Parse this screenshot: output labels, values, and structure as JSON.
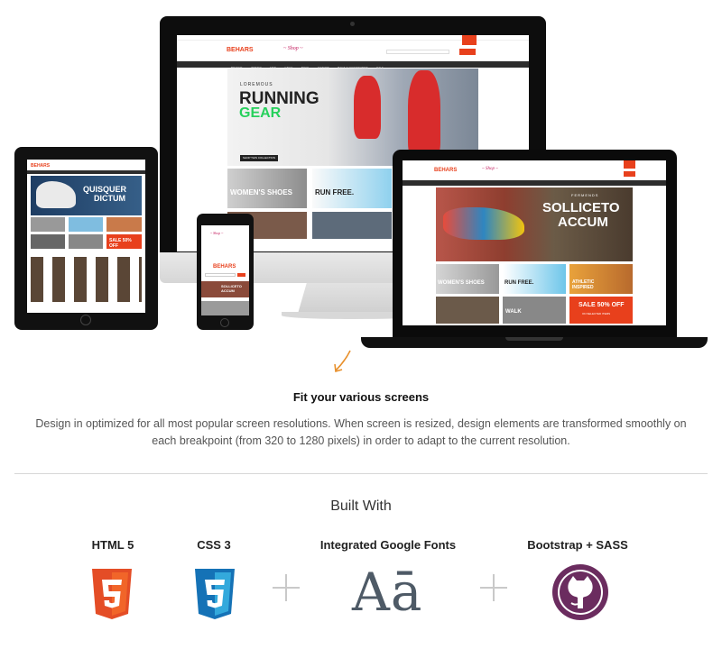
{
  "devices": {
    "imac": {
      "brand": "BEHARS",
      "hero_kicker": "LOREMOUS",
      "hero_line1": "RUNNING",
      "hero_line2": "GEAR",
      "hero_cta": "SHOP THIS COLLECTION",
      "tile1": "WOMEN'S SHOES",
      "tile2": "RUN FREE.",
      "nav": [
        "BRANDS",
        "WOMEN",
        "MEN",
        "GIRLS",
        "BOYS",
        "JUNIORS",
        "BAGS & ACCESSORIES",
        "SALE"
      ]
    },
    "tablet": {
      "brand": "BEHARS",
      "hero_line1": "QUISQUER",
      "hero_line2": "DICTUM",
      "sale": "SALE 50% OFF"
    },
    "phone": {
      "brand": "BEHARS",
      "hero": "SOLLICETO ACCUM"
    },
    "laptop": {
      "brand": "BEHARS",
      "hero_kicker": "FERMENDS",
      "hero_line1": "SOLLICETO",
      "hero_line2": "ACCUM",
      "tile1": "WOMEN'S SHOES",
      "tile2": "RUN FREE.",
      "tile3": "ATHLETIC INSPIRED",
      "tile4": "WALK",
      "sale": "SALE 50% OFF",
      "sale_sub": "ON SELECTED ITEMS"
    }
  },
  "section": {
    "title": "Fit your various screens",
    "description": "Design in optimized for all most popular screen resolutions. When screen is resized, design elements are transformed smoothly on each breakpoint (from 320 to 1280 pixels) in order to adapt to the current resolution."
  },
  "built_with": {
    "heading": "Built With",
    "items": [
      {
        "label": "HTML 5",
        "icon": "html5-icon",
        "glyph": "5",
        "color": "#e44d26"
      },
      {
        "label": "CSS 3",
        "icon": "css3-icon",
        "glyph": "3",
        "color": "#1572b6"
      },
      {
        "label": "Integrated Google Fonts",
        "icon": "google-fonts-icon",
        "glyph": "Aā",
        "color": "#4e5a66"
      },
      {
        "label": "Bootstrap + SASS",
        "icon": "github-octocat-icon",
        "color": "#6b2c5f"
      }
    ]
  }
}
